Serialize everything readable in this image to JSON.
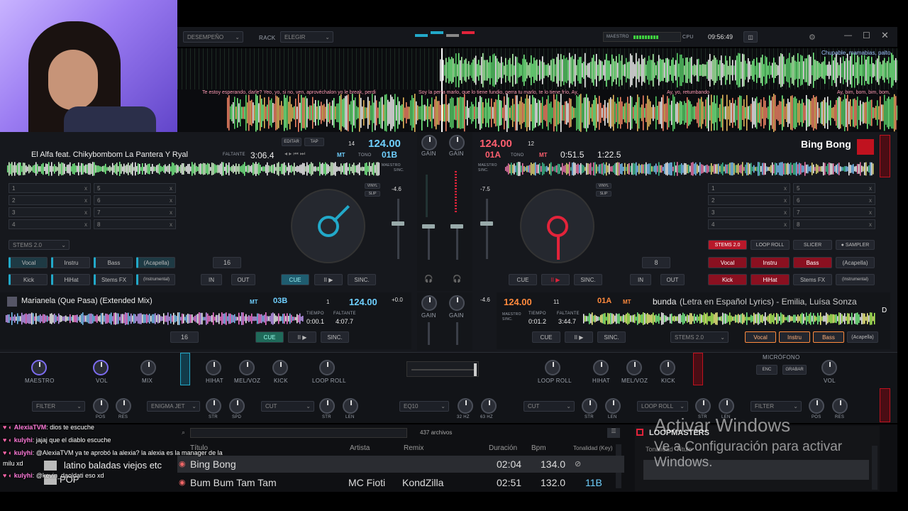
{
  "topbar": {
    "mode": "DESEMPEÑO",
    "rack": "RACK",
    "rack_value": "ELEGIR",
    "master": "MAESTRO",
    "cpu": "CPU",
    "time": "09:56:49"
  },
  "overlay": {
    "top_right": "Chupable, mamabias, palto",
    "lyric_a": "Te estoy esperando, darle? Yeo, yo, si no, ven, aprovéchalon yo le break, perdi",
    "lyric_b": "Soy la perra marlo, que lo tiene fundio, perra tu marlo, te lo tiene frío, Ay,",
    "lyric_c": "Ay, yo, retumbando",
    "lyric_d": "Ay, bim, bom, bim, bom,"
  },
  "deck1": {
    "title": "El Alfa feat. Chikybombom La Pantera Y Ryal",
    "remain_label": "FALTANTE",
    "remain": "3:06.4",
    "edit": "EDITAR",
    "tap": "TAP",
    "bpm": "124.00",
    "key": "01B",
    "mt": "MT",
    "tono": "TONO",
    "num": "14",
    "master": "MAESTRO",
    "sinc": "SINC.",
    "pitch": "-4.6",
    "loop": "16",
    "in": "IN",
    "out": "OUT",
    "cue": "CUE",
    "play": "II ▶",
    "sync": "SINC.",
    "vinyl": "VINYL",
    "slip": "SLIP",
    "stems": "STEMS 2.0",
    "pads": [
      "Vocal",
      "Instru",
      "Bass",
      "(Acapella)",
      "Kick",
      "HiHat",
      "Stems FX",
      "(Instrumental)"
    ],
    "cues": [
      "1",
      "2",
      "3",
      "4",
      "5",
      "6",
      "7",
      "8"
    ]
  },
  "deck2": {
    "title": "Bing Bong",
    "bpm": "124.00",
    "key": "01A",
    "num": "12",
    "elapsed": "0:51.5",
    "remain": "1:22.5",
    "mt": "MT",
    "tono": "TONO",
    "master": "MAESTRO",
    "sinc": "SINC.",
    "pitch": "-7.5",
    "loop": "8",
    "in": "IN",
    "out": "OUT",
    "cue": "CUE",
    "play": "II ▶",
    "sync": "SINC.",
    "vinyl": "VINYL",
    "slip": "SLIP",
    "tabs": [
      "STEMS 2.0",
      "LOOP ROLL",
      "SLICER",
      "● SAMPLER"
    ],
    "pads": [
      "Vocal",
      "Instru",
      "Bass",
      "(Acapella)",
      "Kick",
      "HiHat",
      "Stems FX",
      "(Instrumental)"
    ],
    "cues": [
      "1",
      "2",
      "3",
      "4",
      "5",
      "6",
      "7",
      "8"
    ]
  },
  "deck3": {
    "title": "Marianela (Que Pasa) (Extended Mix)",
    "mt": "MT",
    "key": "03B",
    "num": "1",
    "bpm": "124.00",
    "tempo_label": "TIEMPO",
    "tempo": "0:00.1",
    "remain_label": "FALTANTE",
    "remain": "4:07.7",
    "pitch": "+0.0",
    "loop": "16",
    "cue": "CUE",
    "play": "II ▶",
    "sync": "SINC.",
    "master": "MAESTRO"
  },
  "deck4": {
    "title": "bunda",
    "subtitle": "(Letra en Español Lyrics) - Emilia, Luísa Sonza",
    "bpm": "124.00",
    "num": "11",
    "key": "01A",
    "mt": "MT",
    "tempo_label": "TIEMPO",
    "tempo": "0:01.2",
    "remain_label": "FALTANTE",
    "remain": "3:44.7",
    "pitch": "-4.6",
    "cue": "CUE",
    "play": "II ▶",
    "sync": "SINC.",
    "stems": "STEMS 2.0",
    "pads": [
      "Vocal",
      "Instru",
      "Bass",
      "(Acapella)"
    ],
    "side": "D",
    "master": "MAESTRO",
    "sinc": "SINC."
  },
  "mixer": {
    "gain": "GAIN",
    "maestro": "MAESTRO",
    "vol": "VOL",
    "mix": "MIX",
    "hihat": "HIHAT",
    "melvoz": "MEL/VOZ",
    "kick": "KICK",
    "loop_roll": "LOOP ROLL",
    "filter": "FILTER",
    "pos": "POS",
    "res": "RES",
    "enigma": "ENIGMA JET",
    "str": "STR",
    "spd": "SPD",
    "cut": "CUT",
    "len": "LEN",
    "eq": "EQ10",
    "hz32": "32 Hz",
    "hz63": "63 Hz",
    "mic": "MICRÓFONO",
    "enc": "ENC",
    "grabar": "GRABAR"
  },
  "browser": {
    "files": "437 archivos",
    "cols": [
      "Título",
      "Artista",
      "Remix",
      "Duración",
      "Bpm",
      "Tonalidad (Key)"
    ],
    "rows": [
      {
        "title": "Bing Bong",
        "artist": "",
        "remix": "",
        "dur": "02:04",
        "bpm": "134.0",
        "key": ""
      },
      {
        "title": "Bum Bum Tam Tam",
        "artist": "MC Fioti",
        "remix": "KondZilla",
        "dur": "02:51",
        "bpm": "132.0",
        "key": "11B"
      }
    ],
    "folders": [
      "latino baladas viejos etc",
      "POP"
    ],
    "side_title": "LOOPMASTERS",
    "side_col": "Tonalidad",
    "side_col2": "Título"
  },
  "chat": [
    {
      "user": "AlexiaTVM",
      "msg": ": dios te escuche"
    },
    {
      "user": "kulyhi",
      "msg": ": jajaj que el diablo escuche"
    },
    {
      "user": "kulyhi",
      "msg": ": @AlexiaTVM ya te aprobó la alexia? la alexia es la manager de la"
    },
    {
      "user": "",
      "msg": "milu xd"
    },
    {
      "user": "kulyhi",
      "msg": ": @kevin_daoldati eso xd"
    }
  ],
  "windows": {
    "line1": "Activar Windows",
    "line2": "Ve a Configuración para activar",
    "line3": "Windows."
  },
  "colors": {
    "accent_blue": "#22a9c9",
    "accent_red": "#e2233a",
    "green_wave": "#7CFC8A",
    "panel": "#16181d"
  }
}
